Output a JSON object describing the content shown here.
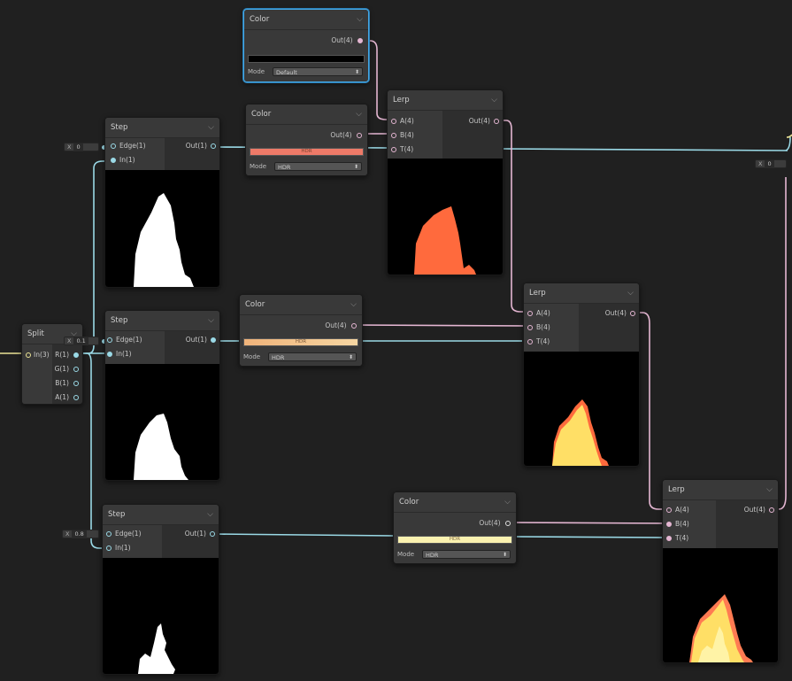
{
  "nodes": {
    "color_black": {
      "title": "Color",
      "out": "Out(4)",
      "mode_label": "Mode",
      "mode_value": "Default",
      "swatch_text": "",
      "swatch_color": "#000000"
    },
    "color_red": {
      "title": "Color",
      "out": "Out(4)",
      "mode_label": "Mode",
      "mode_value": "HDR",
      "swatch_text": "HDR",
      "swatch_color": "#ee7a68"
    },
    "color_orange": {
      "title": "Color",
      "out": "Out(4)",
      "mode_label": "Mode",
      "mode_value": "HDR",
      "swatch_text": "HDR",
      "swatch_color": "#f2c08a"
    },
    "color_yellow": {
      "title": "Color",
      "out": "Out(4)",
      "mode_label": "Mode",
      "mode_value": "HDR",
      "swatch_text": "HDR",
      "swatch_color": "#fbf2b0"
    },
    "step1": {
      "title": "Step",
      "in1": "Edge(1)",
      "in2": "In(1)",
      "out": "Out(1)",
      "edge_x": "X",
      "edge_value": "0"
    },
    "step2": {
      "title": "Step",
      "in1": "Edge(1)",
      "in2": "In(1)",
      "out": "Out(1)",
      "edge_x": "X",
      "edge_value": "0.1"
    },
    "step3": {
      "title": "Step",
      "in1": "Edge(1)",
      "in2": "In(1)",
      "out": "Out(1)",
      "edge_x": "X",
      "edge_value": "0.8"
    },
    "lerp1": {
      "title": "Lerp",
      "in1": "A(4)",
      "in2": "B(4)",
      "in3": "T(4)",
      "out": "Out(4)"
    },
    "lerp2": {
      "title": "Lerp",
      "in1": "A(4)",
      "in2": "B(4)",
      "in3": "T(4)",
      "out": "Out(4)"
    },
    "lerp3": {
      "title": "Lerp",
      "in1": "A(4)",
      "in2": "B(4)",
      "in3": "T(4)",
      "out": "Out(4)"
    },
    "split": {
      "title": "Split",
      "in": "In(3)",
      "out_r": "R(1)",
      "out_g": "G(1)",
      "out_b": "B(1)",
      "out_a": "A(1)"
    },
    "right_field": {
      "x": "X",
      "value": "0"
    }
  },
  "colors": {
    "background": "#202020",
    "wire_float": "#9ad9e6",
    "wire_vector4": "#e4b6d2",
    "wire_vector3": "#ebe395",
    "selected_outline": "#44a8e6",
    "fire_red": "#ff6a3d",
    "fire_yellow": "#ffdf66",
    "fire_orange": "#ff7b52"
  }
}
